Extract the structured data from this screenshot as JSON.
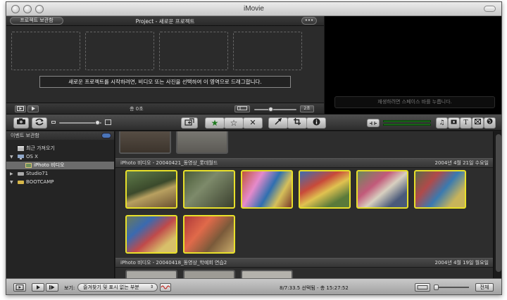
{
  "app": {
    "title": "iMovie"
  },
  "project": {
    "back_button": "프로젝트 보관함",
    "title": "Project - 새로운 프로젝트",
    "more_button": "•••",
    "drop_hint": "새로운 프로젝트를 시작하려면, 비디오 또는 사진을 선택하여 이 영역으로 드래그합니다.",
    "duration": "총 0초",
    "zoom_value": "2초"
  },
  "viewer": {
    "hint": "재생하려면 스페이스 바를 누릅니다."
  },
  "sidebar": {
    "header": "이벤트 보관함",
    "items": [
      {
        "label": "최근 가져오기",
        "icon": "clapper-icon"
      },
      {
        "label": "OS X",
        "icon": "computer-icon"
      },
      {
        "label": "iPhoto 비디오",
        "icon": "iphoto-icon"
      },
      {
        "label": "Studio71",
        "icon": "disk-icon"
      },
      {
        "label": "BOOTCAMP",
        "icon": "disk-icon"
      }
    ]
  },
  "events": [
    {
      "title": "iPhoto 비디오 - 20040421_동영상_롯데월드",
      "date": "2004년 4월 21일 수요일"
    },
    {
      "title": "iPhoto 비디오 - 20040418_동영상_학예회 연습2",
      "date": "2004년 4월 19일 월요일"
    }
  ],
  "bottom": {
    "show_label": "보기:",
    "filter_value": "즐겨찾기 및 표시 없는 부분",
    "status": "8/7:33.5 선택됨 - 총 15:27:52",
    "all_button": "전체"
  },
  "colors": {
    "selection_border": "#e8e02a",
    "favorite_green": "#3fbf3f"
  }
}
